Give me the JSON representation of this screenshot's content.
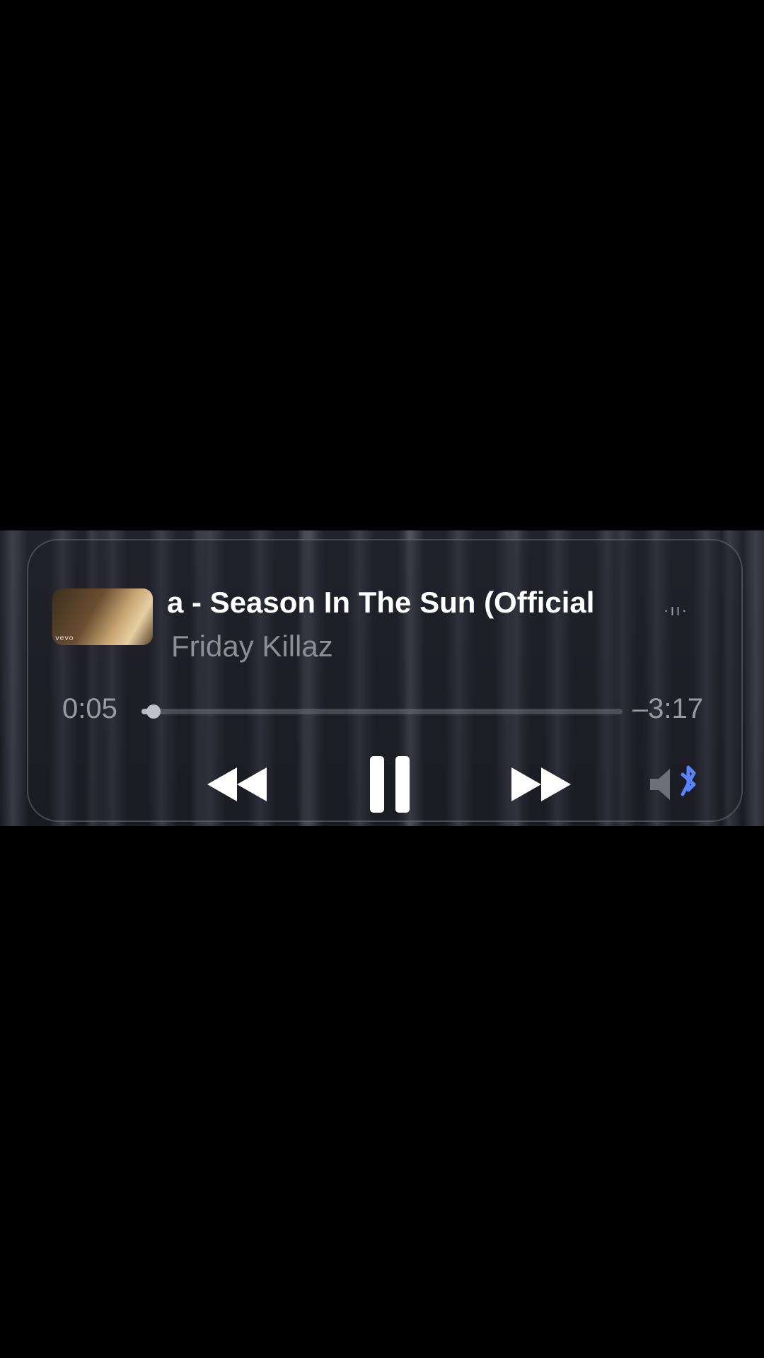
{
  "now_playing": {
    "title": "a - Season In The Sun (Official",
    "artist": "Friday Killaz",
    "artwork_badge": "vevo",
    "airplay_indicator": "·ıı·"
  },
  "progress": {
    "elapsed": "0:05",
    "remaining": "–3:17",
    "fraction": 0.025
  },
  "controls": {
    "rewind_icon": "rewind-icon",
    "pause_icon": "pause-icon",
    "fast_forward_icon": "fast-forward-icon",
    "audio_output_icon": "speaker-bluetooth-icon"
  },
  "colors": {
    "title": "#ffffff",
    "artist": "#8e8e96",
    "bluetooth_accent": "#5a82ff"
  }
}
